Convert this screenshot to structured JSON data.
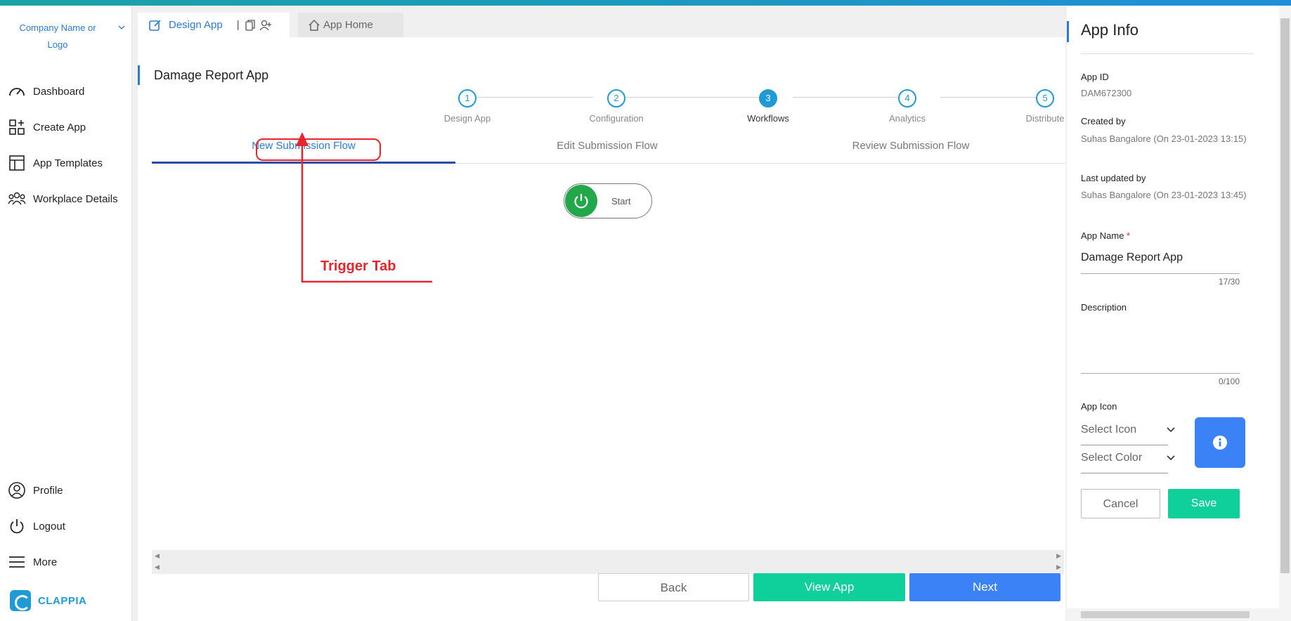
{
  "sidebar": {
    "company": "Company Name or Logo",
    "items": [
      {
        "label": "Dashboard",
        "icon": "dashboard-icon"
      },
      {
        "label": "Create App",
        "icon": "create-app-icon"
      },
      {
        "label": "App Templates",
        "icon": "templates-icon"
      },
      {
        "label": "Workplace Details",
        "icon": "team-icon"
      }
    ],
    "bottom_items": [
      {
        "label": "Profile",
        "icon": "user-icon"
      },
      {
        "label": "Logout",
        "icon": "power-icon"
      },
      {
        "label": "More",
        "icon": "menu-icon"
      }
    ],
    "brand": "CLAPPIA"
  },
  "tabs": {
    "design": "Design App",
    "separator": "|",
    "home": "App Home"
  },
  "main": {
    "title": "Damage Report App",
    "steps": [
      {
        "num": "1",
        "label": "Design App"
      },
      {
        "num": "2",
        "label": "Configuration"
      },
      {
        "num": "3",
        "label": "Workflows",
        "active": true
      },
      {
        "num": "4",
        "label": "Analytics"
      },
      {
        "num": "5",
        "label": "Distribute"
      }
    ],
    "flow_tabs": [
      "New Submission Flow",
      "Edit Submission Flow",
      "Review Submission Flow"
    ],
    "start_node": "Start",
    "annotation": "Trigger Tab",
    "buttons": {
      "back": "Back",
      "view": "View App",
      "next": "Next"
    }
  },
  "app_info": {
    "title": "App Info",
    "app_id_label": "App ID",
    "app_id": "DAM672300",
    "created_label": "Created by",
    "created_value": "Suhas Bangalore (On 23-01-2023 13:15)",
    "updated_label": "Last updated by",
    "updated_value": "Suhas Bangalore (On 23-01-2023 13:45)",
    "name_label": "App Name",
    "name_required": "*",
    "name_value": "Damage Report App",
    "name_counter": "17/30",
    "desc_label": "Description",
    "desc_value": "",
    "desc_counter": "0/100",
    "icon_label": "App Icon",
    "select_icon": "Select Icon",
    "select_color": "Select Color",
    "cancel": "Cancel",
    "save": "Save"
  },
  "colors": {
    "accent": "#2b7bd6",
    "step": "#1e9bd7",
    "green": "#0fcf9b",
    "blue_button": "#3b82f6",
    "annotation": "#e8252b"
  }
}
